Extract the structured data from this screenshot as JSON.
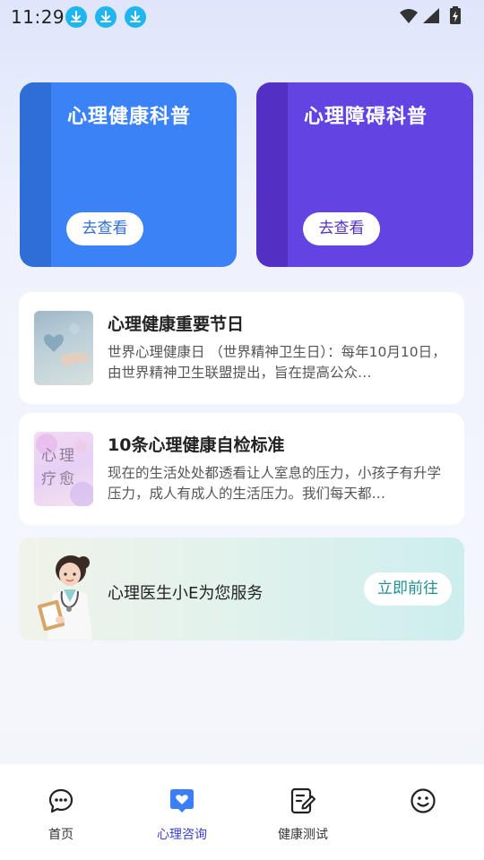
{
  "status_bar": {
    "time": "11:29",
    "left_icons": [
      "download-icon",
      "download-icon",
      "download-icon"
    ],
    "right_icons": [
      "wifi-icon",
      "signal-icon",
      "battery-charging-icon"
    ]
  },
  "top_cards": [
    {
      "title": "心理健康科普",
      "button": "去查看",
      "color": "#3b82f6"
    },
    {
      "title": "心理障碍科普",
      "button": "去查看",
      "color": "#6343e2"
    }
  ],
  "articles": [
    {
      "title": "心理健康重要节日",
      "description": "世界心理健康日 （世界精神卫生日）：每年10月10日，由世界精神卫生联盟提出，旨在提高公众…",
      "thumb_icon": "heart-hand-image"
    },
    {
      "title": "10条心理健康自检标准",
      "description": "现在的生活处处都透看让人室息的压力，小孩子有升学压力，成人有成人的生活压力。我们每天都…",
      "thumb_text": "心理疗愈"
    }
  ],
  "doctor_banner": {
    "text": "心理医生小E为您服务",
    "button": "立即前往"
  },
  "bottom_nav": [
    {
      "label": "首页",
      "icon": "chat-bubble-icon",
      "active": false
    },
    {
      "label": "心理咨询",
      "icon": "heart-message-icon",
      "active": true
    },
    {
      "label": "健康测试",
      "icon": "edit-note-icon",
      "active": false
    },
    {
      "label": "",
      "icon": "smiley-face-icon",
      "active": false
    }
  ],
  "colors": {
    "accent": "#3d3fd0",
    "blue_card": "#3b82f6",
    "purple_card": "#6343e2",
    "teal_button_text": "#1f8f96"
  }
}
